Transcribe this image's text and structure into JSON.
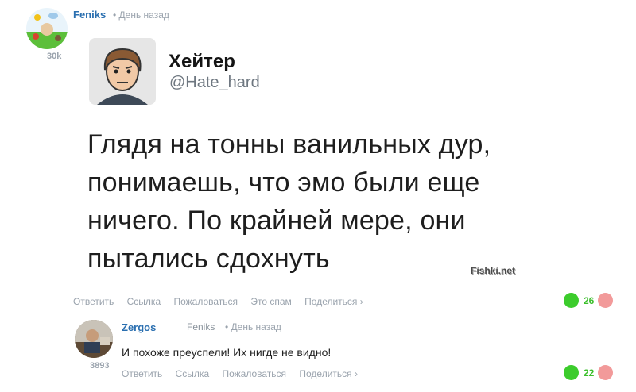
{
  "comment": {
    "author": "Feniks",
    "time": "• День назад",
    "karma": "30k",
    "rating": "26",
    "actions": [
      "Ответить",
      "Ссылка",
      "Пожаловаться",
      "Это спам",
      "Поделиться ›"
    ]
  },
  "tweet": {
    "name": "Хейтер",
    "handle": "@Hate_hard",
    "lines": [
      "Глядя на тонны ванильных дур,",
      "понимаешь, что эмо были еще",
      "ничего. По крайней мере, они",
      "пытались сдохнуть"
    ],
    "watermark": "Fishki.net"
  },
  "reply": {
    "author": "Zergos",
    "reply_to": "Feniks",
    "time": "• День назад",
    "text": "И похоже преуспели! Их нигде не видно!",
    "karma": "3893",
    "rating": "22",
    "actions": [
      "Ответить",
      "Ссылка",
      "Пожаловаться",
      "Поделиться ›"
    ]
  },
  "colors": {
    "link": "#2a6fb0",
    "upvote": "#3ccc2c",
    "downvote": "#f29a9a",
    "muted": "#9aa3ad"
  }
}
